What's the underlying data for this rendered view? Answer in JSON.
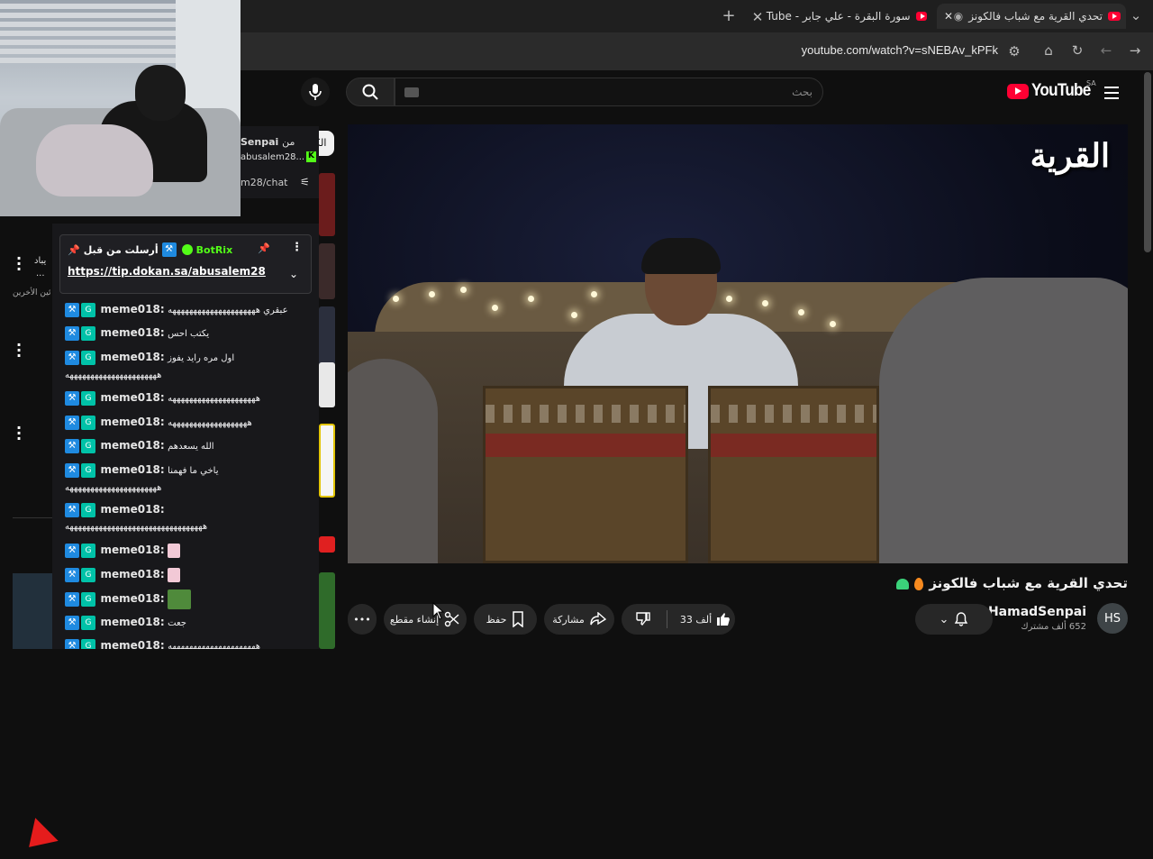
{
  "browser": {
    "tabs": [
      {
        "title": "تحدي القرية مع شباب فالكونز",
        "active": true
      },
      {
        "title": "سورة البقرة - علي جابر - YouTube",
        "active": false
      }
    ],
    "new_tab_label": "+",
    "url": "youtube.com/watch?v=sNEBAv_kPFk"
  },
  "youtube": {
    "logo_text": "YouTube",
    "region": "SA",
    "search_placeholder": "بحث",
    "chip_all": "الكل"
  },
  "chat": {
    "header": {
      "from_label": "من",
      "user": "Senpai",
      "channel": "abusalem28...",
      "path": "m28/chat"
    },
    "pinned": {
      "sent_by_label": "أرسلت من قبل",
      "bot_name": "BotRix",
      "link": "https://tip.dokan.sa/abusalem28"
    },
    "messages": [
      {
        "user": "meme018:",
        "text": "عبقري هههههههههههههههههههههه"
      },
      {
        "user": "meme018:",
        "text": "يكتب احس"
      },
      {
        "user": "meme018:",
        "text": "اول مره رايد يفوز",
        "text2": "ههههههههههههههههههههههه"
      },
      {
        "user": "meme018:",
        "text": "هههههههههههههههههههههه"
      },
      {
        "user": "meme018:",
        "text": "هههههههههههههههههههه"
      },
      {
        "user": "meme018:",
        "text": "الله يسعدهم"
      },
      {
        "user": "meme018:",
        "text": "ياخي ما فهمنا",
        "text2": "ههههههههههههههههههههههه"
      },
      {
        "user": "meme018:",
        "text": "",
        "text2": "هههههههههههههههههههههههههههههههههه"
      },
      {
        "user": "meme018:",
        "text": ""
      },
      {
        "user": "meme018:",
        "text": ""
      },
      {
        "user": "meme018:",
        "text": ""
      },
      {
        "user": "meme018:",
        "text": "جعت"
      },
      {
        "user": "meme018:",
        "text": "هههههههههههههههههههههه"
      }
    ],
    "left_snippets": [
      "يباد",
      "...",
      "ئين الأخرين"
    ]
  },
  "video": {
    "overlay_title": "القرية",
    "title": "تحدي القرية مع شباب فالكونز",
    "channel": "HamadSenpai",
    "subscribers": "652 ألف مشترك",
    "avatar_text": "HS",
    "likes": "33 ألف",
    "share_label": "مشاركة",
    "save_label": "حفظ",
    "clip_label": "إنشاء مقطع",
    "more_label": "•••"
  }
}
